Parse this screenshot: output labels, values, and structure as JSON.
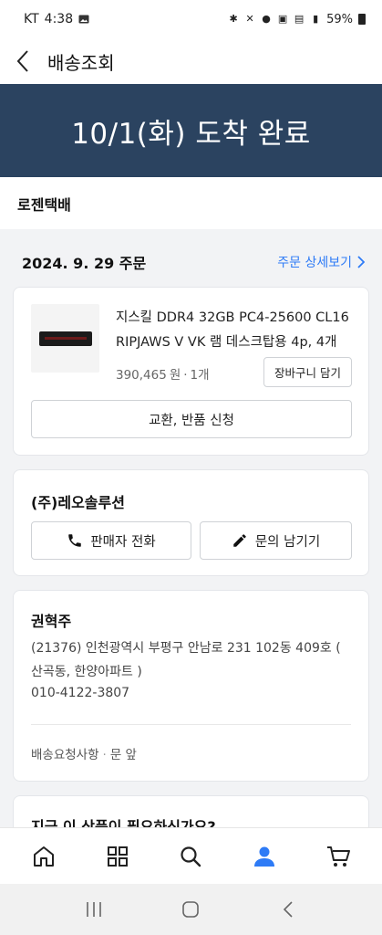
{
  "status_bar": {
    "carrier": "KT",
    "time": "4:38",
    "battery": "59%"
  },
  "header": {
    "title": "배송조회"
  },
  "banner": {
    "text": "10/1(화) 도착 완료"
  },
  "courier": {
    "name": "로젠택배"
  },
  "order": {
    "date": "2024. 9. 29 주문",
    "detail_link": "주문 상세보기"
  },
  "product": {
    "name": "지스킬 DDR4 32GB PC4-25600 CL16 RIPJAWS V VK 램 데스크탑용 4p, 4개",
    "price": "390,465",
    "price_unit": "원",
    "quantity": "1개",
    "cart_button": "장바구니 담기",
    "return_button": "교환, 반품 신청"
  },
  "seller": {
    "name": "(주)레오솔루션",
    "call_button": "판매자 전화",
    "inquiry_button": "문의 남기기"
  },
  "recipient": {
    "name": "권혁주",
    "address": "(21376) 인천광역시 부평구 안남로 231 102동 409호 ( 산곡동, 한양아파트 )",
    "phone": "010-4122-3807",
    "request_label": "배송요청사항",
    "request_value": "문 앞"
  },
  "teaser": {
    "text": "지금 이 상품이 필요하신가요?"
  },
  "bottom_nav": {
    "items": [
      "home-icon",
      "category-icon",
      "search-icon",
      "my-account-icon",
      "cart-icon"
    ],
    "active_color": "#2e7bf6"
  },
  "colors": {
    "banner_bg": "#2b4360",
    "link": "#2e7bf6"
  }
}
